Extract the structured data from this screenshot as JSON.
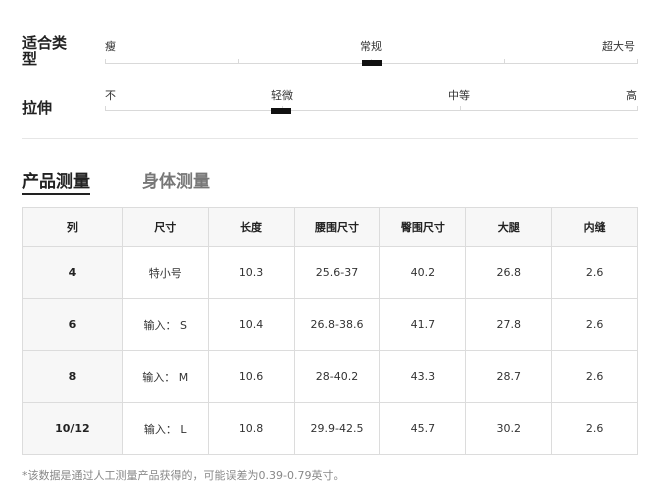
{
  "fit": {
    "label": "适合类型",
    "ticks": [
      "瘦",
      "常规",
      "超大号"
    ],
    "value_percent": 50
  },
  "stretch": {
    "label": "拉伸",
    "ticks": [
      "不",
      "轻微",
      "中等",
      "高"
    ],
    "value_percent": 33
  },
  "tabs": [
    {
      "label": "产品测量",
      "active": true
    },
    {
      "label": "身体测量",
      "active": false
    }
  ],
  "table": {
    "headers": [
      "列",
      "尺寸",
      "长度",
      "腰围尺寸",
      "臀围尺寸",
      "大腿",
      "内缝"
    ],
    "rows": [
      [
        "4",
        "特小号",
        "10.3",
        "25.6-37",
        "40.2",
        "26.8",
        "2.6"
      ],
      [
        "6",
        "输入： S",
        "10.4",
        "26.8-38.6",
        "41.7",
        "27.8",
        "2.6"
      ],
      [
        "8",
        "输入： M",
        "10.6",
        "28-40.2",
        "43.3",
        "28.7",
        "2.6"
      ],
      [
        "10/12",
        "输入： L",
        "10.8",
        "29.9-42.5",
        "45.7",
        "30.2",
        "2.6"
      ]
    ]
  },
  "note": "*该数据是通过人工测量产品获得的，可能误差为0.39-0.79英寸。"
}
